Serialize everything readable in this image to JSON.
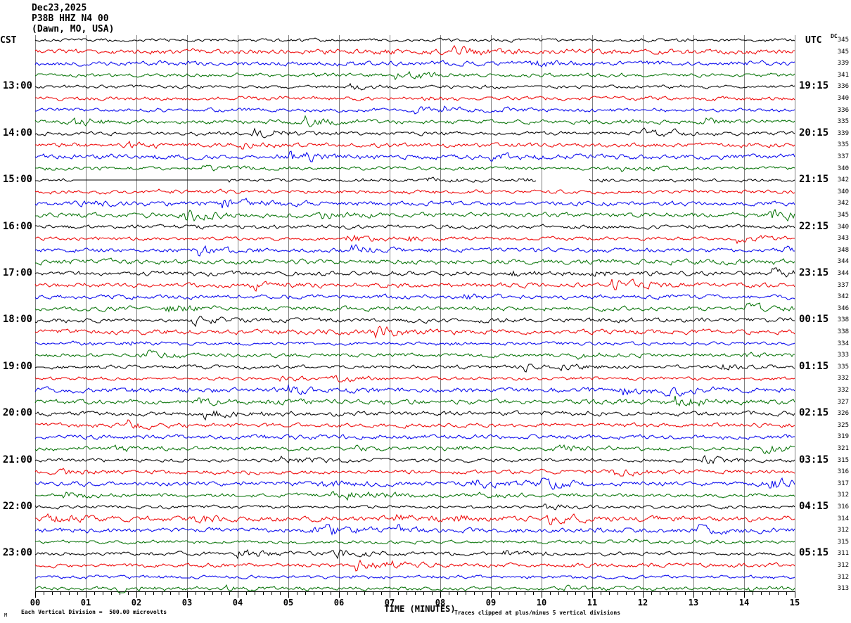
{
  "title": {
    "date": "Dec23,2025",
    "station": "P38B HHZ N4 00",
    "location": "(Dawn, MO, USA)"
  },
  "axes": {
    "left_header": "CST",
    "right_header": "UTC",
    "dc_header": "DC",
    "x_title": "TIME (MINUTES)",
    "x_tick_labels": [
      "00",
      "01",
      "02",
      "03",
      "04",
      "05",
      "06",
      "07",
      "08",
      "09",
      "10",
      "11",
      "12",
      "13",
      "14",
      "15"
    ]
  },
  "footer": {
    "scale_note": "Each Vertical Division =  500.00 microvolts",
    "clip_note": "Traces clipped at plus/minus 5 vertical divisions",
    "corner_mark": "M"
  },
  "colors": {
    "black": "#000000",
    "red": "#ee0000",
    "blue": "#0000ee",
    "green": "#007000",
    "grid": "#7f7f7f",
    "axis": "#000000",
    "background": "#ffffff"
  },
  "chart_data": {
    "type": "line",
    "subtype": "helicorder-seismogram",
    "x_axis": {
      "label": "TIME (MINUTES)",
      "min": 0,
      "max": 15,
      "major_tick_minutes": 1,
      "minor_tick_seconds": 10
    },
    "y_scale": {
      "division_microvolts": 500.0,
      "clip_divisions": 5
    },
    "trace_color_cycle": [
      "black",
      "red",
      "blue",
      "green"
    ],
    "row_count": 48,
    "minutes_per_row": 15,
    "rows": [
      {
        "dc": 345
      },
      {
        "dc": 345
      },
      {
        "dc": 339
      },
      {
        "dc": 341
      },
      {
        "cst": "13:00",
        "utc": "19:15",
        "dc": 336
      },
      {
        "dc": 340
      },
      {
        "dc": 336
      },
      {
        "dc": 335
      },
      {
        "cst": "14:00",
        "utc": "20:15",
        "dc": 339
      },
      {
        "dc": 335
      },
      {
        "dc": 337
      },
      {
        "dc": 340
      },
      {
        "cst": "15:00",
        "utc": "21:15",
        "dc": 342,
        "flat_segments_min": [
          [
            0.76,
            3.82
          ]
        ],
        "gap_segments_min": [
          [
            9.89,
            10.94
          ]
        ]
      },
      {
        "dc": 340
      },
      {
        "dc": 342
      },
      {
        "dc": 345
      },
      {
        "cst": "16:00",
        "utc": "22:15",
        "dc": 340
      },
      {
        "dc": 343
      },
      {
        "dc": 348
      },
      {
        "dc": 344
      },
      {
        "cst": "17:00",
        "utc": "23:15",
        "dc": 344
      },
      {
        "dc": 337,
        "burst_min": [
          11.4
        ]
      },
      {
        "dc": 342
      },
      {
        "dc": 346
      },
      {
        "cst": "18:00",
        "utc": "00:15",
        "dc": 338
      },
      {
        "dc": 338
      },
      {
        "dc": 334
      },
      {
        "dc": 333
      },
      {
        "cst": "19:00",
        "utc": "01:15",
        "dc": 335
      },
      {
        "dc": 332
      },
      {
        "dc": 332
      },
      {
        "dc": 327
      },
      {
        "cst": "20:00",
        "utc": "02:15",
        "dc": 326
      },
      {
        "dc": 325
      },
      {
        "dc": 319
      },
      {
        "dc": 321
      },
      {
        "cst": "21:00",
        "utc": "03:15",
        "dc": 315
      },
      {
        "dc": 316
      },
      {
        "dc": 317
      },
      {
        "dc": 312
      },
      {
        "cst": "22:00",
        "utc": "04:15",
        "dc": 316
      },
      {
        "dc": 314
      },
      {
        "dc": 312
      },
      {
        "dc": 315
      },
      {
        "cst": "23:00",
        "utc": "05:15",
        "dc": 311
      },
      {
        "dc": 312
      },
      {
        "dc": 312
      },
      {
        "dc": 313
      }
    ]
  }
}
